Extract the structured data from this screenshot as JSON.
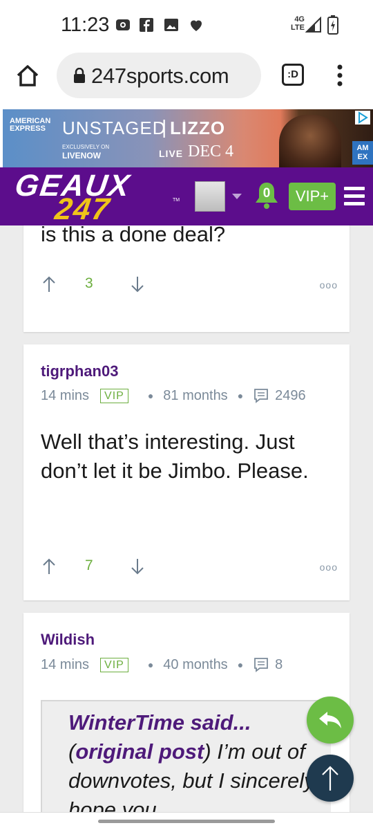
{
  "status_bar": {
    "time": "11:23",
    "network": "4G LTE"
  },
  "browser": {
    "url": "247sports.com",
    "tabs_label": ":D"
  },
  "ad": {
    "brand": "AMERICAN EXPRESS",
    "campaign": "UNSTAGED",
    "artist": "LIZZO",
    "exclusively_on": "EXCLUSIVELY ON",
    "platform": "LIVENOW",
    "live": "LIVE",
    "date": "DEC 4",
    "badge": "AM EX"
  },
  "site_header": {
    "logo_top": "GEAUX",
    "logo_bottom": "247",
    "tm": "TM",
    "notifications": "0",
    "vip_button": "VIP+"
  },
  "posts": [
    {
      "body": "is this a done deal?",
      "upvotes": "3"
    },
    {
      "username": "tigrphan03",
      "time": "14 mins",
      "vip": "VIP",
      "tenure": "81 months",
      "post_count": "2496",
      "body": "Well that’s interesting. Just don’t let it be Jimbo. Please.",
      "upvotes": "7"
    },
    {
      "username": "Wildish",
      "time": "14 mins",
      "vip": "VIP",
      "tenure": "40 months",
      "post_count": "8",
      "quote_author": "WinterTime said...",
      "quote_link": "original post",
      "quote_open": "(",
      "quote_text": ") I’m out of downvotes, but I sincerely hope you"
    }
  ],
  "more_label": "ooo",
  "colors": {
    "brand_purple": "#5c0d8c",
    "vip_green": "#6cae3e",
    "reply_fab": "#6cbd45",
    "top_fab": "#1f3a4f"
  }
}
